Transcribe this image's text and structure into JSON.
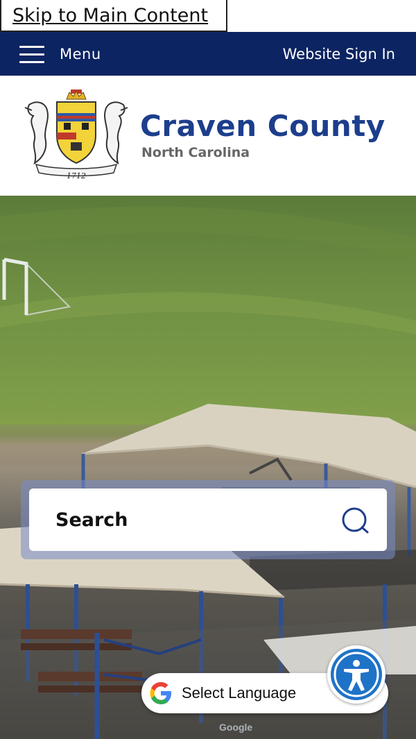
{
  "skip_link": "Skip to Main Content",
  "topbar": {
    "menu_label": "Menu",
    "signin_label": "Website Sign In"
  },
  "brand": {
    "name": "Craven County",
    "state": "North Carolina",
    "seal_year": "1712"
  },
  "search": {
    "placeholder": "Search"
  },
  "translate": {
    "label": "Select Language",
    "powered_by": "Google"
  },
  "colors": {
    "nav_bg": "#0c2461",
    "brand_blue": "#1d3e8c",
    "access_blue": "#1f73c7"
  },
  "icons": [
    "menu-icon",
    "county-seal-logo",
    "search-icon",
    "google-g-icon",
    "accessibility-icon"
  ]
}
